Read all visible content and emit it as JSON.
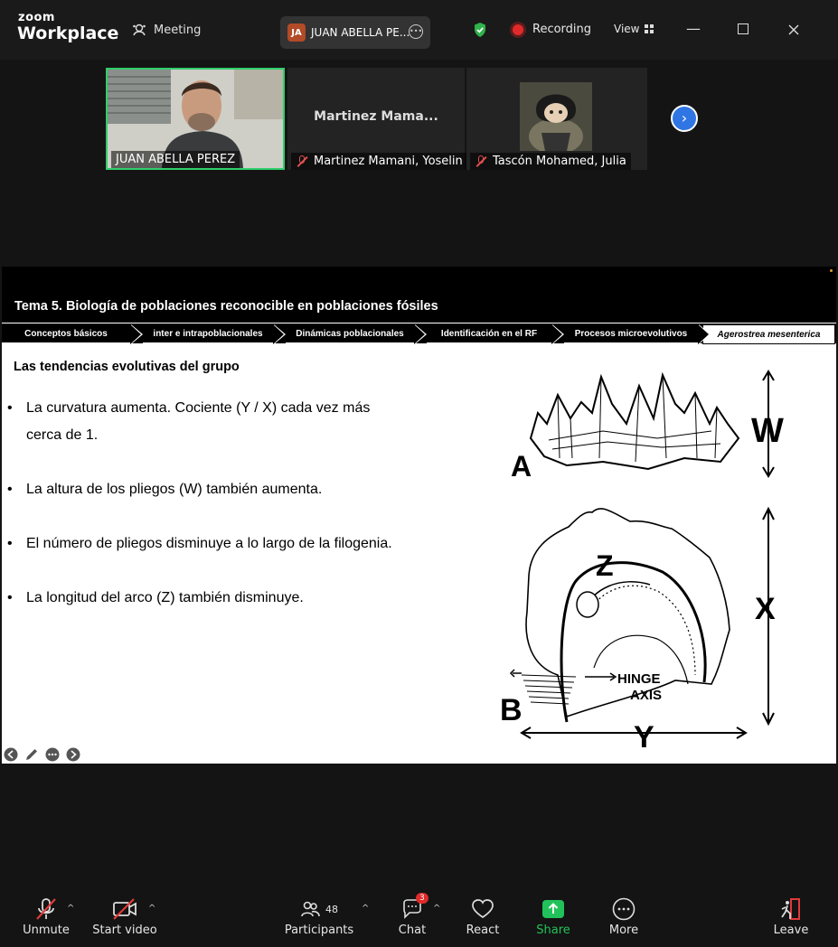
{
  "app": {
    "brand_top": "zoom",
    "brand_bottom": "Workplace"
  },
  "header": {
    "meeting_label": "Meeting",
    "host_initials": "JA",
    "host_name": "JUAN ABELLA PE...",
    "recording_label": "Recording",
    "view_label": "View"
  },
  "gallery": {
    "tiles": [
      {
        "name": "JUAN ABELLA PEREZ",
        "muted": false
      },
      {
        "display": "Martinez Mama...",
        "name": "Martinez Mamani, Yoselin",
        "muted": true
      },
      {
        "name": "Tascón Mohamed, Julia",
        "muted": true
      }
    ]
  },
  "slide": {
    "title": "Tema 5. Biología de poblaciones reconocible en poblaciones fósiles",
    "nav": [
      "Conceptos básicos",
      "inter e intrapoblacionales",
      "Dinámicas poblacionales",
      "Identificación en el RF",
      "Procesos microevolutivos",
      "Agerostrea mesenterica"
    ],
    "subtitle": "Las tendencias evolutivas del grupo",
    "bullets": [
      "La curvatura aumenta. Cociente (Y / X) cada vez más cerca de 1.",
      "La altura de los pliegos (W) también aumenta.",
      "El número de pliegos disminuye a lo largo de la filogenia.",
      "La longitud del arco (Z) también disminuye."
    ],
    "figure_labels": {
      "a": "A",
      "w": "W",
      "z": "Z",
      "x": "X",
      "b": "B",
      "y": "Y",
      "hinge": "HINGE",
      "axis": "AXIS"
    }
  },
  "toolbar": {
    "unmute": "Unmute",
    "start_video": "Start video",
    "participants": "Participants",
    "participants_count": "48",
    "chat": "Chat",
    "chat_badge": "3",
    "react": "React",
    "share": "Share",
    "more": "More",
    "leave": "Leave"
  }
}
